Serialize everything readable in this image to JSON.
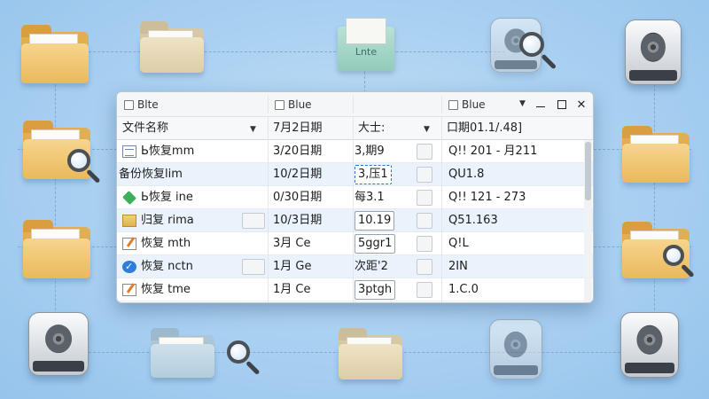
{
  "window": {
    "titlebar": {
      "items": [
        "Blte",
        "Blue",
        "Blue"
      ],
      "controls": [
        "minimize",
        "maximize",
        "close"
      ]
    },
    "columns": [
      "文件名称",
      "7月2日期",
      "大士:",
      "口期01.1/.48]"
    ],
    "rows": [
      {
        "icon": "document-icon",
        "name": "Ь恢复mm",
        "date": "3/20日期",
        "size": "3,期9",
        "size_style": "plain",
        "extra": "Q!! 201 - 月211"
      },
      {
        "icon": "none",
        "name": "备份恢复lim",
        "date": "10/2日期",
        "size": "3,压1",
        "size_style": "selected",
        "extra": "QU1.8"
      },
      {
        "icon": "green-cube-icon",
        "name": "Ь恢复 ine",
        "date": "0/30日期",
        "size": "每3.1",
        "size_style": "plain",
        "extra": "Q!! 121 - 273"
      },
      {
        "icon": "image-file-icon",
        "name": "归复 rima",
        "date": "10/3日期",
        "size": "10.19",
        "size_style": "box",
        "extra": "Q51.163"
      },
      {
        "icon": "edit-file-icon",
        "name": "恢复 mth",
        "date": "3月 Ce",
        "size": "5ggr1",
        "size_style": "box",
        "extra": "Q!L"
      },
      {
        "icon": "check-circle-icon",
        "name": "恢复 nctn",
        "date": "1月 Ge",
        "size": "次距'2",
        "size_style": "plain",
        "extra": "2IN"
      },
      {
        "icon": "edit-file-icon",
        "name": "恢复 tme",
        "date": "1月 Ce",
        "size": "3ptgh",
        "size_style": "box",
        "extra": "1.C.0"
      }
    ]
  },
  "background_icons": [
    "folder-icon",
    "drive-icon",
    "magnifier-icon",
    "tag-icon"
  ],
  "tag_label": "Lnte",
  "colors": {
    "background": "#a9d0f1",
    "row_alt": "#eaf2fb",
    "folder": "#eab95c",
    "selection": "#2f6fc4"
  }
}
